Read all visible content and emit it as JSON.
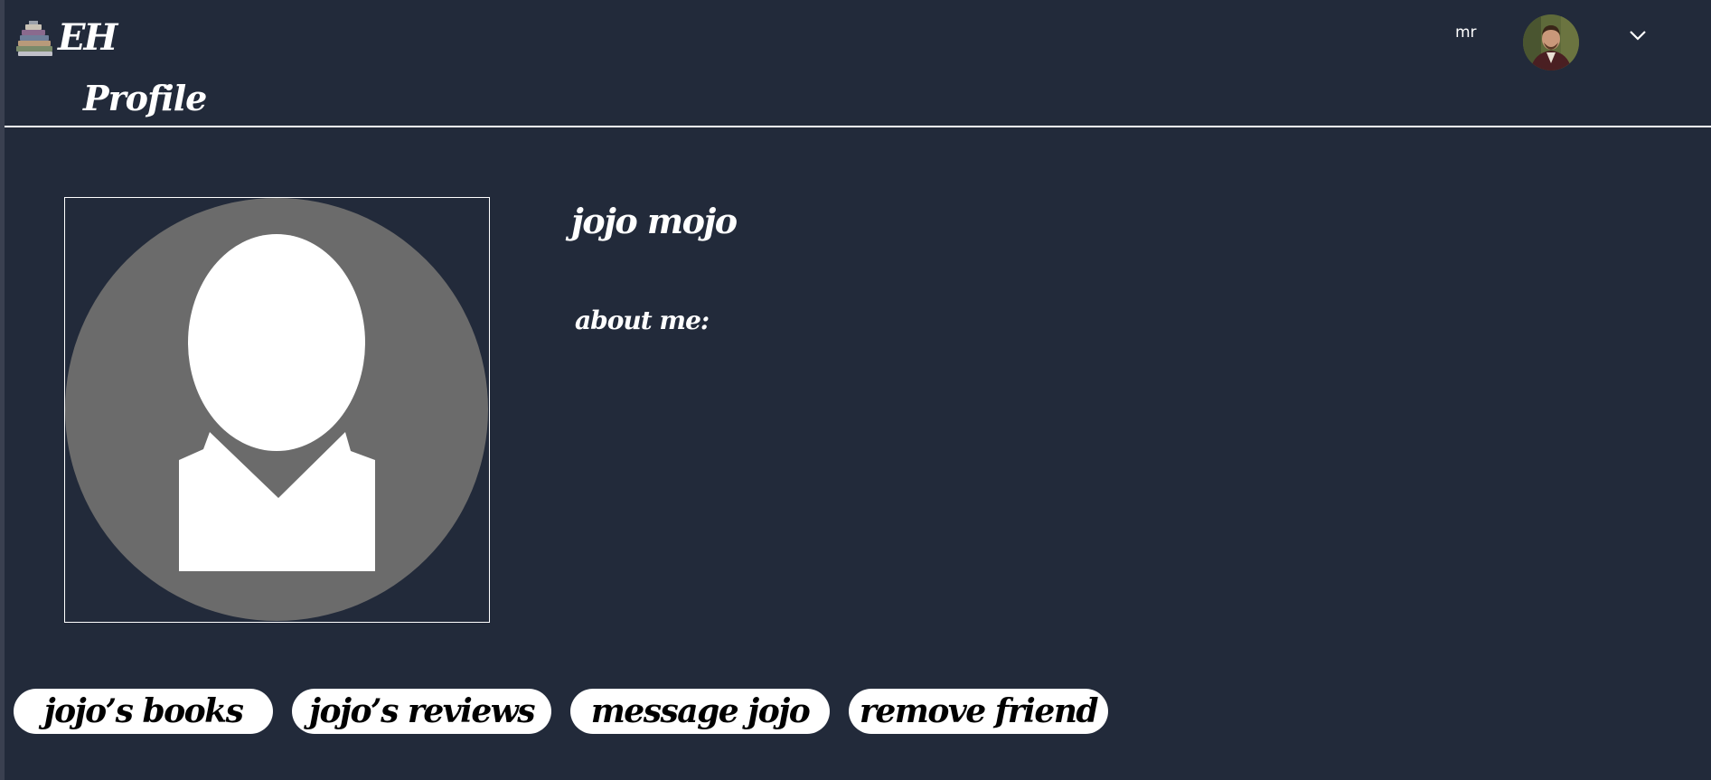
{
  "header": {
    "logo_text": "EH",
    "page_title": "Profile",
    "user_initials": "mr",
    "menu_icon": "chevron-down-icon"
  },
  "profile": {
    "name": "jojo mojo",
    "about_label": "about me:",
    "photo_icon": "default-avatar-icon"
  },
  "actions": {
    "books_label": "jojo’s books",
    "reviews_label": "jojo’s reviews",
    "message_label": "message jojo",
    "remove_label": "remove friend"
  },
  "colors": {
    "background": "#222a3a",
    "text": "#ffffff",
    "button_bg": "#ffffff",
    "button_text": "#000000",
    "avatar_placeholder": "#6b6b6b"
  }
}
